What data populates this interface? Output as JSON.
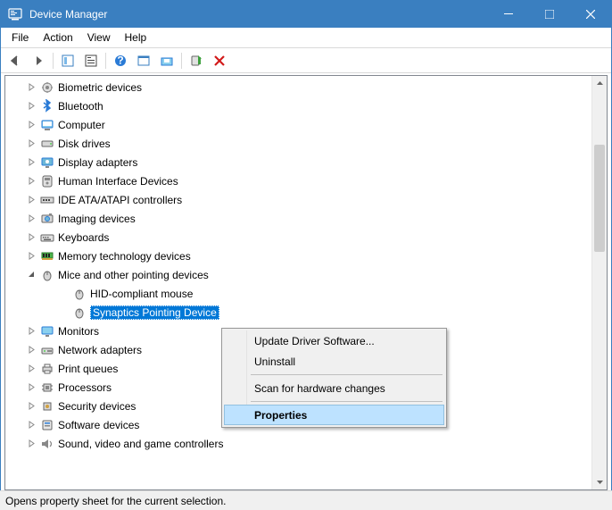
{
  "window": {
    "title": "Device Manager"
  },
  "menubar": [
    "File",
    "Action",
    "View",
    "Help"
  ],
  "tree": {
    "items": [
      {
        "label": "Biometric devices",
        "level": 1,
        "icon": "sensor",
        "expanded": false,
        "hasChildren": true
      },
      {
        "label": "Bluetooth",
        "level": 1,
        "icon": "bluetooth",
        "expanded": false,
        "hasChildren": true
      },
      {
        "label": "Computer",
        "level": 1,
        "icon": "computer",
        "expanded": false,
        "hasChildren": true
      },
      {
        "label": "Disk drives",
        "level": 1,
        "icon": "disk",
        "expanded": false,
        "hasChildren": true
      },
      {
        "label": "Display adapters",
        "level": 1,
        "icon": "display",
        "expanded": false,
        "hasChildren": true
      },
      {
        "label": "Human Interface Devices",
        "level": 1,
        "icon": "hid",
        "expanded": false,
        "hasChildren": true
      },
      {
        "label": "IDE ATA/ATAPI controllers",
        "level": 1,
        "icon": "ide",
        "expanded": false,
        "hasChildren": true
      },
      {
        "label": "Imaging devices",
        "level": 1,
        "icon": "imaging",
        "expanded": false,
        "hasChildren": true
      },
      {
        "label": "Keyboards",
        "level": 1,
        "icon": "keyboard",
        "expanded": false,
        "hasChildren": true
      },
      {
        "label": "Memory technology devices",
        "level": 1,
        "icon": "memory",
        "expanded": false,
        "hasChildren": true
      },
      {
        "label": "Mice and other pointing devices",
        "level": 1,
        "icon": "mouse",
        "expanded": true,
        "hasChildren": true
      },
      {
        "label": "HID-compliant mouse",
        "level": 2,
        "icon": "mouse",
        "expanded": false,
        "hasChildren": false
      },
      {
        "label": "Synaptics Pointing Device",
        "level": 2,
        "icon": "mouse",
        "expanded": false,
        "hasChildren": false,
        "selected": true
      },
      {
        "label": "Monitors",
        "level": 1,
        "icon": "monitor",
        "expanded": false,
        "hasChildren": true
      },
      {
        "label": "Network adapters",
        "level": 1,
        "icon": "network",
        "expanded": false,
        "hasChildren": true
      },
      {
        "label": "Print queues",
        "level": 1,
        "icon": "printer",
        "expanded": false,
        "hasChildren": true
      },
      {
        "label": "Processors",
        "level": 1,
        "icon": "cpu",
        "expanded": false,
        "hasChildren": true
      },
      {
        "label": "Security devices",
        "level": 1,
        "icon": "security",
        "expanded": false,
        "hasChildren": true
      },
      {
        "label": "Software devices",
        "level": 1,
        "icon": "software",
        "expanded": false,
        "hasChildren": true
      },
      {
        "label": "Sound, video and game controllers",
        "level": 1,
        "icon": "sound",
        "expanded": false,
        "hasChildren": true
      }
    ]
  },
  "contextMenu": {
    "items": [
      {
        "label": "Update Driver Software...",
        "highlight": false
      },
      {
        "label": "Uninstall",
        "highlight": false
      },
      {
        "sep": true
      },
      {
        "label": "Scan for hardware changes",
        "highlight": false
      },
      {
        "sep": true
      },
      {
        "label": "Properties",
        "highlight": true,
        "bold": true
      }
    ]
  },
  "statusbar": {
    "text": "Opens property sheet for the current selection."
  }
}
